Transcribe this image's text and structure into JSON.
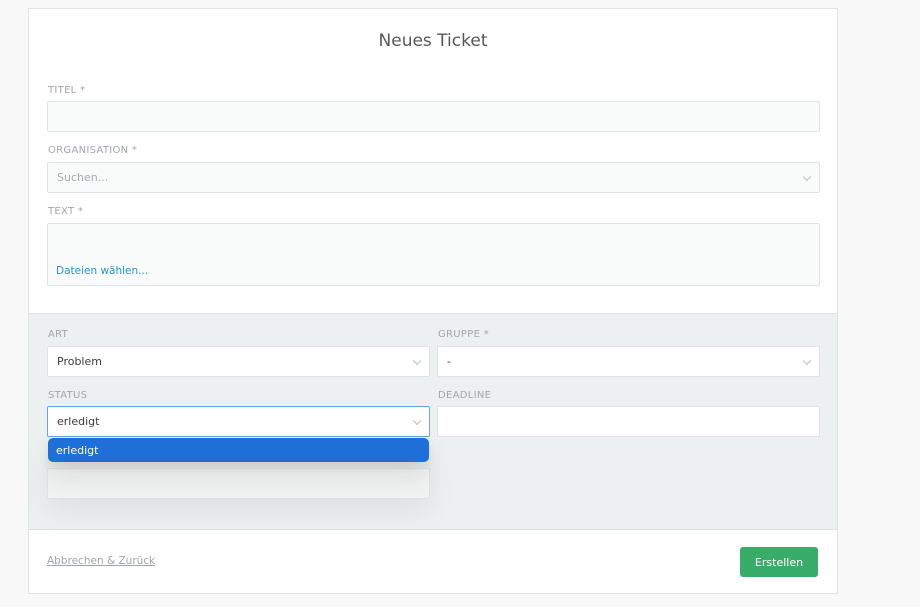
{
  "page": {
    "title": "Neues Ticket"
  },
  "form": {
    "title_label": "TITEL *",
    "title_value": "",
    "org_label": "ORGANISATION *",
    "org_placeholder": "Suchen...",
    "text_label": "TEXT *",
    "files_link": "Dateien wählen..."
  },
  "attributes": {
    "art_label": "ART",
    "art_value": "Problem",
    "gruppe_label": "GRUPPE *",
    "gruppe_value": "-",
    "status_label": "STATUS",
    "status_value": "erledigt",
    "deadline_label": "DEADLINE",
    "deadline_value": "",
    "status_options": [
      "erledigt"
    ]
  },
  "footer": {
    "cancel_label": "Abbrechen & Zurück",
    "create_label": "Erstellen"
  },
  "colors": {
    "accent": "#1f6fd9",
    "create_button": "#38ad69",
    "link": "#2f8fcb"
  }
}
